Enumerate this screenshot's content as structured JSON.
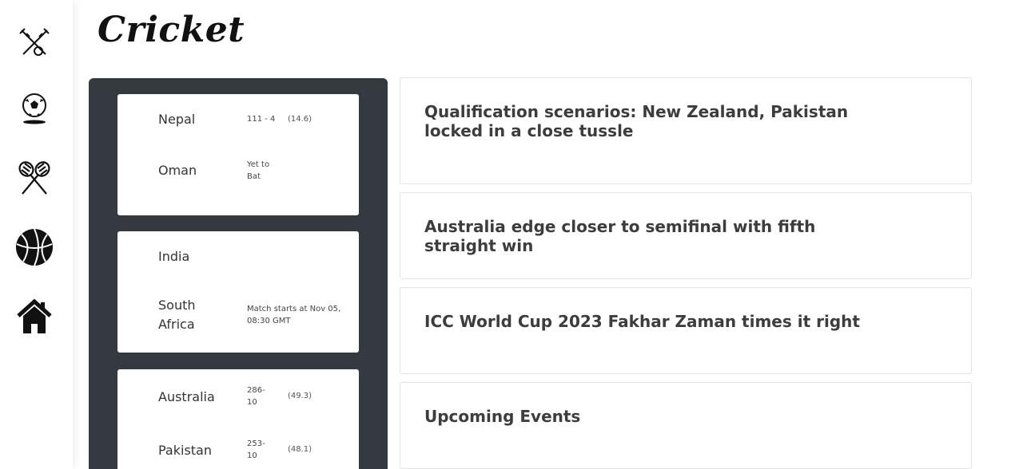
{
  "sidebar": {
    "items": [
      {
        "name": "cricket-icon"
      },
      {
        "name": "football-icon"
      },
      {
        "name": "badminton-icon"
      },
      {
        "name": "basketball-icon"
      },
      {
        "name": "home-icon"
      }
    ]
  },
  "page": {
    "title": "Cricket"
  },
  "matches": [
    {
      "team1": {
        "name": "Nepal",
        "score": "111 - 4",
        "overs": "(14.6)"
      },
      "team2": {
        "name": "Oman",
        "status": "Yet to Bat"
      }
    },
    {
      "team1": {
        "name": "India"
      },
      "team2": {
        "name": "South Africa",
        "status": "Match starts at Nov 05, 08:30 GMT"
      }
    },
    {
      "team1": {
        "name": "Australia",
        "score": "286-10",
        "overs": "(49.3)"
      },
      "team2": {
        "name": "Pakistan",
        "score": "253-10",
        "overs": "(48.1)"
      }
    }
  ],
  "news": [
    {
      "title": "Qualification scenarios: New Zealand, Pakistan locked in a close tussle"
    },
    {
      "title": "Australia edge closer to semifinal with fifth straight win"
    },
    {
      "title": "ICC World Cup 2023 Fakhar Zaman times it right"
    },
    {
      "title": "Upcoming Events"
    }
  ]
}
